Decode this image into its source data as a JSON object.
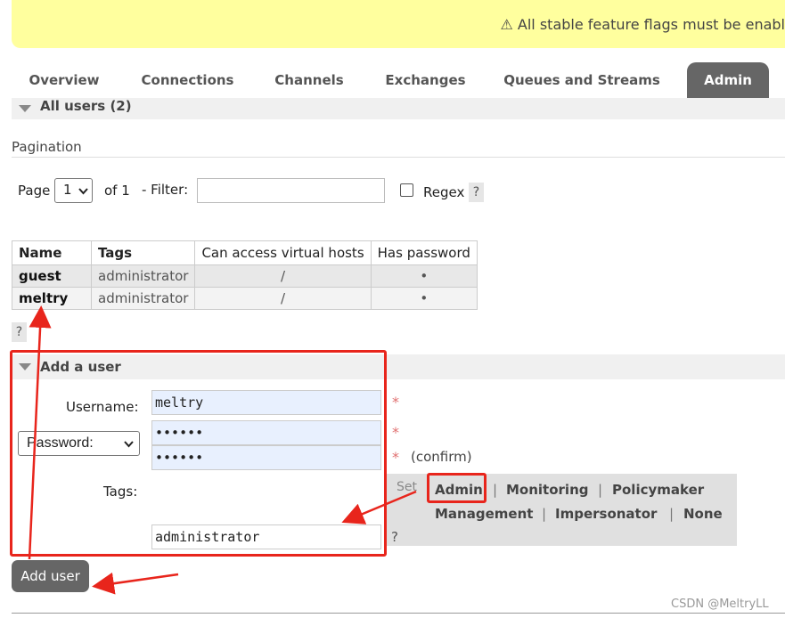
{
  "banner": {
    "text": "⚠ All stable feature flags must be enabl"
  },
  "tabs": [
    {
      "label": "Overview"
    },
    {
      "label": "Connections"
    },
    {
      "label": "Channels"
    },
    {
      "label": "Exchanges"
    },
    {
      "label": "Queues and Streams"
    },
    {
      "label": "Admin"
    }
  ],
  "all_users": {
    "title": "All users (2)"
  },
  "pagination": {
    "heading": "Pagination",
    "page_label": "Page",
    "page_value": "1",
    "of_label": "of 1",
    "filter_label": "- Filter:",
    "filter_value": "",
    "regex_label": "Regex",
    "help": "?"
  },
  "table": {
    "headers": [
      "Name",
      "Tags",
      "Can access virtual hosts",
      "Has password"
    ],
    "rows": [
      {
        "name": "guest",
        "tags": "administrator",
        "vhosts": "/",
        "has_password": "•"
      },
      {
        "name": "meltry",
        "tags": "administrator",
        "vhosts": "/",
        "has_password": "•"
      }
    ],
    "help": "?"
  },
  "add_user": {
    "title": "Add a user",
    "username_label": "Username:",
    "username_value": "meltry",
    "password_option": "Password:",
    "password_value": "••••••",
    "password_confirm_value": "••••••",
    "confirm_label": "(confirm)",
    "required": "*",
    "tags_label": "Tags:",
    "set_label": "Set",
    "tag_options": [
      "Admin",
      "Monitoring",
      "Policymaker",
      "Management",
      "Impersonator",
      "None"
    ],
    "separator": "|",
    "tags_value": "administrator",
    "tags_help": "?",
    "submit_label": "Add user"
  },
  "watermark": "CSDN @MeltryLL",
  "colors": {
    "banner": "#ffff9e",
    "active_tab": "#666666",
    "annotation_red": "#e8251c",
    "field_fill": "#e8f0fe"
  }
}
